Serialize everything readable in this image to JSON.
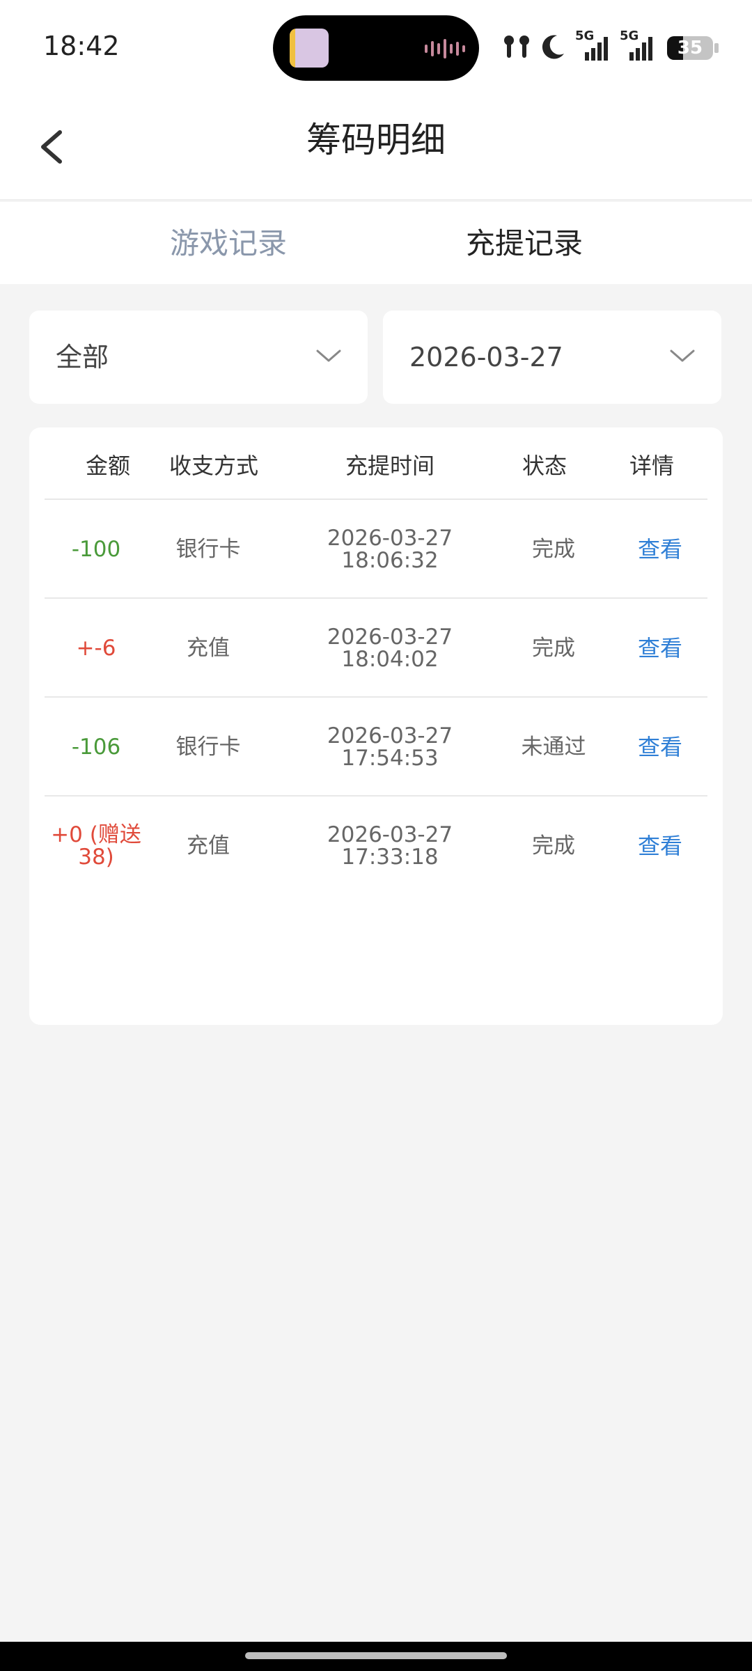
{
  "status_bar": {
    "time": "18:42",
    "network_1": "5G",
    "network_2": "5G",
    "battery": "35",
    "battery_level": 0.35,
    "icons": [
      "earbuds-icon",
      "moon-icon",
      "signal-icon",
      "signal-icon",
      "battery-icon"
    ]
  },
  "header": {
    "title": "筹码明细"
  },
  "tabs": [
    {
      "label": "游戏记录",
      "active": false
    },
    {
      "label": "充提记录",
      "active": true
    }
  ],
  "filters": {
    "type_value": "全部",
    "date_value": "2026-03-27"
  },
  "table": {
    "columns": [
      "金额",
      "收支方式",
      "充提时间",
      "状态",
      "详情"
    ],
    "rows": [
      {
        "amount": "-100",
        "method": "银行卡",
        "date": "2026-03-27",
        "time": "18:06:32",
        "status": "完成",
        "detail": "查看"
      },
      {
        "amount": "+-6",
        "method": "充值",
        "date": "2026-03-27",
        "time": "18:04:02",
        "status": "完成",
        "detail": "查看"
      },
      {
        "amount": "-106",
        "method": "银行卡",
        "date": "2026-03-27",
        "time": "17:54:53",
        "status": "未通过",
        "detail": "查看"
      },
      {
        "amount": "+0 (赠送38)",
        "method": "充值",
        "date": "2026-03-27",
        "time": "17:33:18",
        "status": "完成",
        "detail": "查看"
      }
    ]
  },
  "colors": {
    "negative": "#4a9a3a",
    "positive": "#e04a3a",
    "link": "#2f7fd6",
    "inactive_tab": "#8a97ab"
  }
}
